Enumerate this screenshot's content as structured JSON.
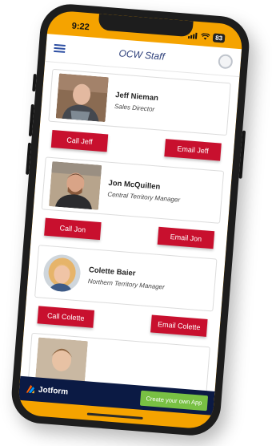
{
  "status_bar": {
    "time": "9:22",
    "battery": "83"
  },
  "header": {
    "title": "OCW Staff",
    "menu_icon": "hamburger-menu-icon",
    "profile_icon": "profile-avatar-icon"
  },
  "staff": [
    {
      "name": "Jeff Nieman",
      "role": "Sales Director",
      "call_label": "Call Jeff",
      "email_label": "Email Jeff"
    },
    {
      "name": "Jon McQuillen",
      "role": "Central Territory Manager",
      "call_label": "Call Jon",
      "email_label": "Email Jon"
    },
    {
      "name": "Colette Baier",
      "role": "Northern Territory Manager",
      "call_label": "Call Colette",
      "email_label": "Email Colette"
    }
  ],
  "footer": {
    "brand": "Jotform",
    "cta": "Create your own App"
  },
  "colors": {
    "accent": "#c8102e",
    "frame_orange": "#f5a300",
    "footer_navy": "#0b1a44",
    "cta_green": "#78c043"
  }
}
